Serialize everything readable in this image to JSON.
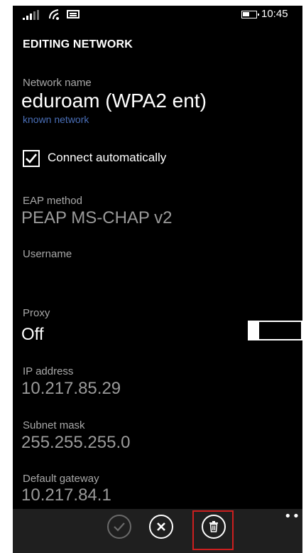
{
  "status_bar": {
    "time": "10:45"
  },
  "header": {
    "title": "EDITING NETWORK"
  },
  "network": {
    "name_label": "Network name",
    "name_value": "eduroam (WPA2 ent)",
    "status": "known network"
  },
  "connect_auto": {
    "label": "Connect automatically",
    "checked": true
  },
  "eap": {
    "label": "EAP method",
    "value": "PEAP MS-CHAP v2"
  },
  "username": {
    "label": "Username",
    "value": ""
  },
  "proxy": {
    "label": "Proxy",
    "value": "Off",
    "toggle_on": false
  },
  "ip": {
    "label": "IP address",
    "value": "10.217.85.29"
  },
  "subnet": {
    "label": "Subnet mask",
    "value": "255.255.255.0"
  },
  "gateway": {
    "label": "Default gateway",
    "value": "10.217.84.1"
  },
  "app_bar": {
    "buttons": [
      "check-icon",
      "cancel-icon",
      "delete-icon"
    ],
    "more": "•••"
  },
  "colors": {
    "background": "#000000",
    "label": "#a8a8a8",
    "link": "#4a6fb8",
    "highlight": "#cc1f1f"
  }
}
